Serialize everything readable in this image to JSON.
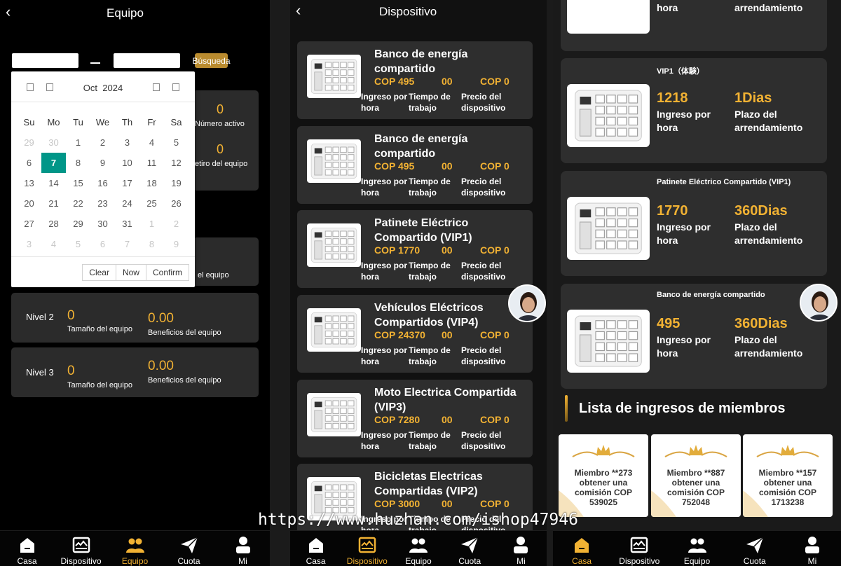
{
  "panel1": {
    "title": "Equipo",
    "search_label": "Búsqueda",
    "calendar": {
      "month": "Oct",
      "year": "2024",
      "weekdays": [
        "Su",
        "Mo",
        "Tu",
        "We",
        "Th",
        "Fr",
        "Sa"
      ],
      "weeks": [
        [
          "29",
          "30",
          "1",
          "2",
          "3",
          "4",
          "5"
        ],
        [
          "6",
          "7",
          "8",
          "9",
          "10",
          "11",
          "12"
        ],
        [
          "13",
          "14",
          "15",
          "16",
          "17",
          "18",
          "19"
        ],
        [
          "20",
          "21",
          "22",
          "23",
          "24",
          "25",
          "26"
        ],
        [
          "27",
          "28",
          "29",
          "30",
          "31",
          "1",
          "2"
        ],
        [
          "3",
          "4",
          "5",
          "6",
          "7",
          "8",
          "9"
        ]
      ],
      "selected_day": "7",
      "clear_label": "Clear",
      "now_label": "Now",
      "confirm_label": "Confirm"
    },
    "partial_card": {
      "value1": "0",
      "label1": "Número activo",
      "value2": "0",
      "label2": "etiro del equipo",
      "label3": "el equipo"
    },
    "levels": [
      {
        "name": "Nivel 2",
        "size": "0",
        "size_label": "Tamaño del equipo",
        "benefit": "0.00",
        "benefit_label": "Beneficios del equipo"
      },
      {
        "name": "Nivel 3",
        "size": "0",
        "size_label": "Tamaño del equipo",
        "benefit": "0.00",
        "benefit_label": "Beneficios del equipo"
      }
    ]
  },
  "panel2": {
    "title": "Dispositivo",
    "labels": {
      "income": "Ingreso por hora",
      "time": "Tiempo de trabajo",
      "price": "Precio del dispositivo"
    },
    "devices": [
      {
        "name": "Banco de energía compartido",
        "income": "COP 495",
        "time": "00",
        "price": "COP 0"
      },
      {
        "name": "Banco de energía compartido",
        "income": "COP 495",
        "time": "00",
        "price": "COP 0"
      },
      {
        "name": "Patinete Eléctrico Compartido  (VIP1)",
        "income": "COP 1770",
        "time": "00",
        "price": "COP 0"
      },
      {
        "name": "Vehículos Eléctricos Compartidos  (VIP4)",
        "income": "COP 24370",
        "time": "00",
        "price": "COP 0"
      },
      {
        "name": "Moto Electrica Compartida   (VIP3)",
        "income": "COP 7280",
        "time": "00",
        "price": "COP 0"
      },
      {
        "name": "Bicicletas Electricas Compartidas  (VIP2)",
        "income": "COP 3000",
        "time": "00",
        "price": "COP 0"
      }
    ]
  },
  "panel3": {
    "top_partial": {
      "income_label": "Ingreso por hora",
      "term_label": "Plazo del arrendamiento"
    },
    "cards": [
      {
        "title": "VIP1（体験）",
        "income": "1218",
        "term": "1Dias",
        "income_label": "Ingreso por hora",
        "term_label": "Plazo del arrendamiento"
      },
      {
        "title": "Patinete Eléctrico Compartido  (VIP1)",
        "income": "1770",
        "term": "360Dias",
        "income_label": "Ingreso por hora",
        "term_label": "Plazo del arrendamiento"
      },
      {
        "title": "Banco de energía compartido",
        "income": "495",
        "term": "360Dias",
        "income_label": "Ingreso por hora",
        "term_label": "Plazo del arrendamiento"
      }
    ],
    "members_heading": "Lista de ingresos de miembros",
    "members": [
      {
        "line1": "Miembro **273",
        "line2": "obtener una",
        "line3": "comisión COP",
        "amount": "539025"
      },
      {
        "line1": "Miembro **887",
        "line2": "obtener una",
        "line3": "comisión COP",
        "amount": "752048"
      },
      {
        "line1": "Miembro **157",
        "line2": "obtener una",
        "line3": "comisión COP",
        "amount": "1713238"
      }
    ]
  },
  "nav": [
    {
      "label": "Casa",
      "icon": "home-icon"
    },
    {
      "label": "Dispositivo",
      "icon": "device-icon"
    },
    {
      "label": "Equipo",
      "icon": "team-icon"
    },
    {
      "label": "Cuota",
      "icon": "send-icon"
    },
    {
      "label": "Mi",
      "icon": "user-icon"
    }
  ],
  "watermark": "https://www.huzhan.com/ishop47946",
  "colors": {
    "accent": "#f2b233",
    "selected_day": "#009688",
    "card": "#2e2e2e"
  }
}
